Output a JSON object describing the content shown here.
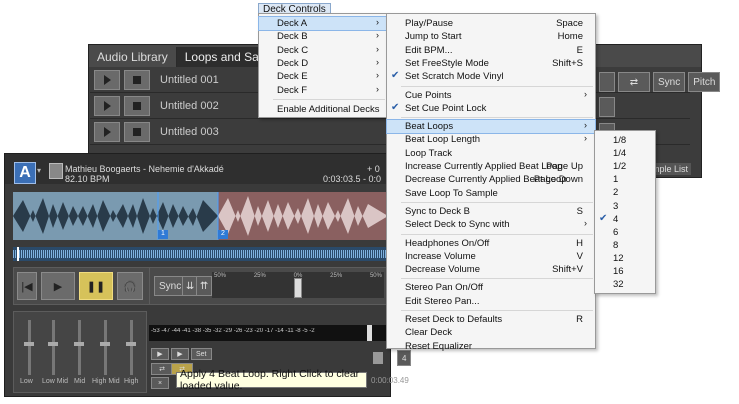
{
  "menu_title": "Deck Controls",
  "library": {
    "tabs": [
      "Audio Library",
      "Loops and Samples"
    ],
    "rows": [
      "Untitled 001",
      "Untitled 002",
      "Untitled 003"
    ],
    "btn_sync": "Sync",
    "btn_pitch": "Pitch",
    "partial_label": "mple List"
  },
  "deck_menu": {
    "items": [
      {
        "label": "Deck A",
        "arrow": true,
        "highlight": true
      },
      {
        "label": "Deck B",
        "arrow": true
      },
      {
        "label": "Deck C",
        "arrow": true
      },
      {
        "label": "Deck D",
        "arrow": true
      },
      {
        "label": "Deck E",
        "arrow": true
      },
      {
        "label": "Deck F",
        "arrow": true
      }
    ],
    "enable_label": "Enable Additional Decks"
  },
  "deck_a_menu": {
    "items": [
      {
        "label": "Play/Pause",
        "shortcut": "Space"
      },
      {
        "label": "Jump to Start",
        "shortcut": "Home"
      },
      {
        "label": "Edit BPM...",
        "shortcut": "E"
      },
      {
        "label": "Set FreeStyle Mode",
        "shortcut": "Shift+S"
      },
      {
        "label": "Set Scratch Mode Vinyl",
        "checked": true
      },
      {
        "sep": true
      },
      {
        "label": "Cue Points",
        "arrow": true
      },
      {
        "label": "Set Cue Point Lock",
        "checked": true
      },
      {
        "sep": true
      },
      {
        "label": "Beat Loops",
        "arrow": true,
        "highlight": true
      },
      {
        "label": "Beat Loop Length",
        "arrow": true
      },
      {
        "label": "Loop Track"
      },
      {
        "label": "Increase Currently Applied Beat Loop",
        "shortcut": "Page Up"
      },
      {
        "label": "Decrease Currently Applied Beat Loop",
        "shortcut": "Page Down"
      },
      {
        "label": "Save Loop To Sample"
      },
      {
        "sep": true
      },
      {
        "label": "Sync to Deck B",
        "shortcut": "S"
      },
      {
        "label": "Select Deck to Sync with",
        "arrow": true
      },
      {
        "sep": true
      },
      {
        "label": "Headphones On/Off",
        "shortcut": "H"
      },
      {
        "label": "Increase Volume",
        "shortcut": "V"
      },
      {
        "label": "Decrease Volume",
        "shortcut": "Shift+V"
      },
      {
        "sep": true
      },
      {
        "label": "Stereo Pan On/Off"
      },
      {
        "label": "Edit Stereo Pan..."
      },
      {
        "sep": true
      },
      {
        "label": "Reset Deck to Defaults",
        "shortcut": "R"
      },
      {
        "label": "Clear Deck"
      },
      {
        "label": "Reset Equalizer"
      }
    ]
  },
  "beat_loops_menu": {
    "items": [
      {
        "label": "1/8"
      },
      {
        "label": "1/4"
      },
      {
        "label": "1/2"
      },
      {
        "label": "1"
      },
      {
        "label": "2"
      },
      {
        "label": "3"
      },
      {
        "label": "4",
        "checked": true
      },
      {
        "label": "6"
      },
      {
        "label": "8"
      },
      {
        "label": "12"
      },
      {
        "label": "16"
      },
      {
        "label": "32"
      }
    ]
  },
  "deck": {
    "letter": "A",
    "track": "Mathieu Boogaerts - Nehemie d'Akkadé",
    "bpm": "82.10 BPM",
    "time": "0:03:03.5 - 0:0",
    "time_prefix": "+ 0",
    "time_small": "0:00:03.49",
    "cue1": "1",
    "cue2": "2",
    "sync": "Sync",
    "key_num": "4",
    "eq_labels": [
      "Low",
      "Low Mid",
      "Mid",
      "High Mid",
      "High"
    ],
    "pitch_scale": [
      "50%",
      "25%",
      "0%",
      "25%",
      "50%"
    ],
    "meter_scale": "-53 -47 -44 -41 -38 -35 -32 -29 -26 -23 -20 -17 -14 -11 -8 -5 -2",
    "set_label": "Set"
  },
  "tooltip": "Apply 4 Beat Loop. Right Click to clear loaded value.",
  "colors": {
    "accent": "#3b6fb6",
    "pause": "#d6c25a",
    "menu_highlight": "#cde3f8"
  }
}
